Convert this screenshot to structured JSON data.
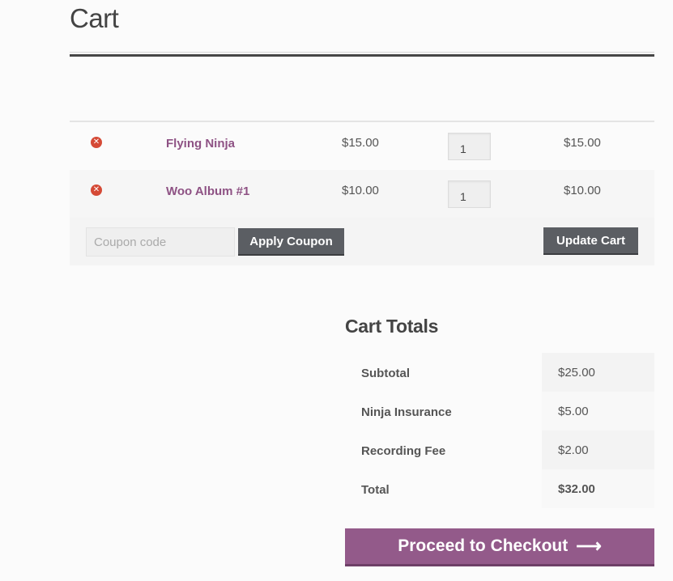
{
  "page": {
    "title": "Cart"
  },
  "cart": {
    "items": [
      {
        "name": "Flying Ninja",
        "price": "$15.00",
        "quantity": "1",
        "subtotal": "$15.00"
      },
      {
        "name": "Woo Album #1",
        "price": "$10.00",
        "quantity": "1",
        "subtotal": "$10.00"
      }
    ],
    "remove_icon": "remove-circle-x-icon",
    "remove_glyph": "✕"
  },
  "actions": {
    "coupon_placeholder": "Coupon code",
    "coupon_value": "",
    "apply_coupon_label": "Apply Coupon",
    "update_cart_label": "Update Cart"
  },
  "totals": {
    "title": "Cart Totals",
    "rows": [
      {
        "label": "Subtotal",
        "value": "$25.00"
      },
      {
        "label": "Ninja Insurance",
        "value": "$5.00"
      },
      {
        "label": "Recording Fee",
        "value": "$2.00"
      },
      {
        "label": "Total",
        "value": "$32.00"
      }
    ]
  },
  "checkout": {
    "label": "Proceed to Checkout",
    "arrow_icon": "right-arrow-icon",
    "arrow_glyph": "⟶"
  },
  "colors": {
    "accent_purple": "#935a8a",
    "link_purple": "#8e5284",
    "button_dark": "#5b5e63",
    "remove_red": "#d54a36"
  }
}
